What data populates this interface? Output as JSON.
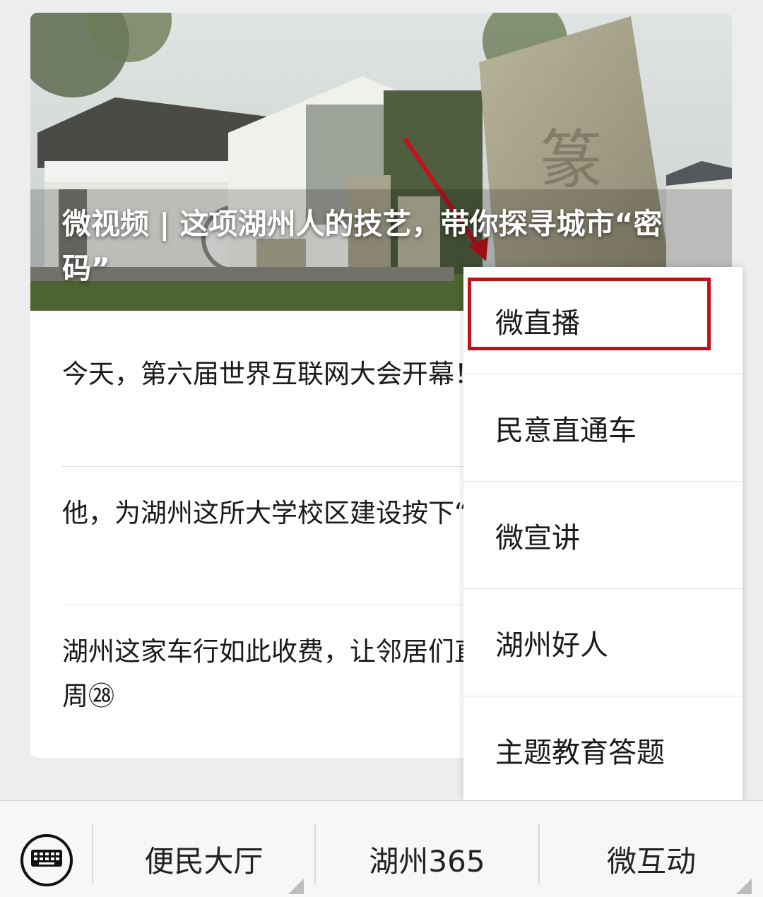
{
  "card": {
    "cover_title": "微视频 | 这项湖州人的技艺，带你探寻城市“密码”",
    "articles": [
      "今天，第六届世界互联网大会开幕！大黑科技抢先体验",
      "他，为湖州这所大学校区建设按下“快进键”",
      "湖州这家车行如此收费，让邻居们直呼“公平”| 文明这一周㉘"
    ]
  },
  "menu": {
    "items": [
      "微直播",
      "民意直通车",
      "微宣讲",
      "湖州好人",
      "主题教育答题"
    ],
    "highlighted_item": "微直播"
  },
  "bottom_bar": {
    "keyboard_icon": "keyboard-icon",
    "tabs": [
      "便民大厅",
      "湖州365",
      "微互动"
    ]
  },
  "colors": {
    "highlight_border": "#c1121c",
    "arrow": "#c1121c",
    "background": "#ededed"
  }
}
